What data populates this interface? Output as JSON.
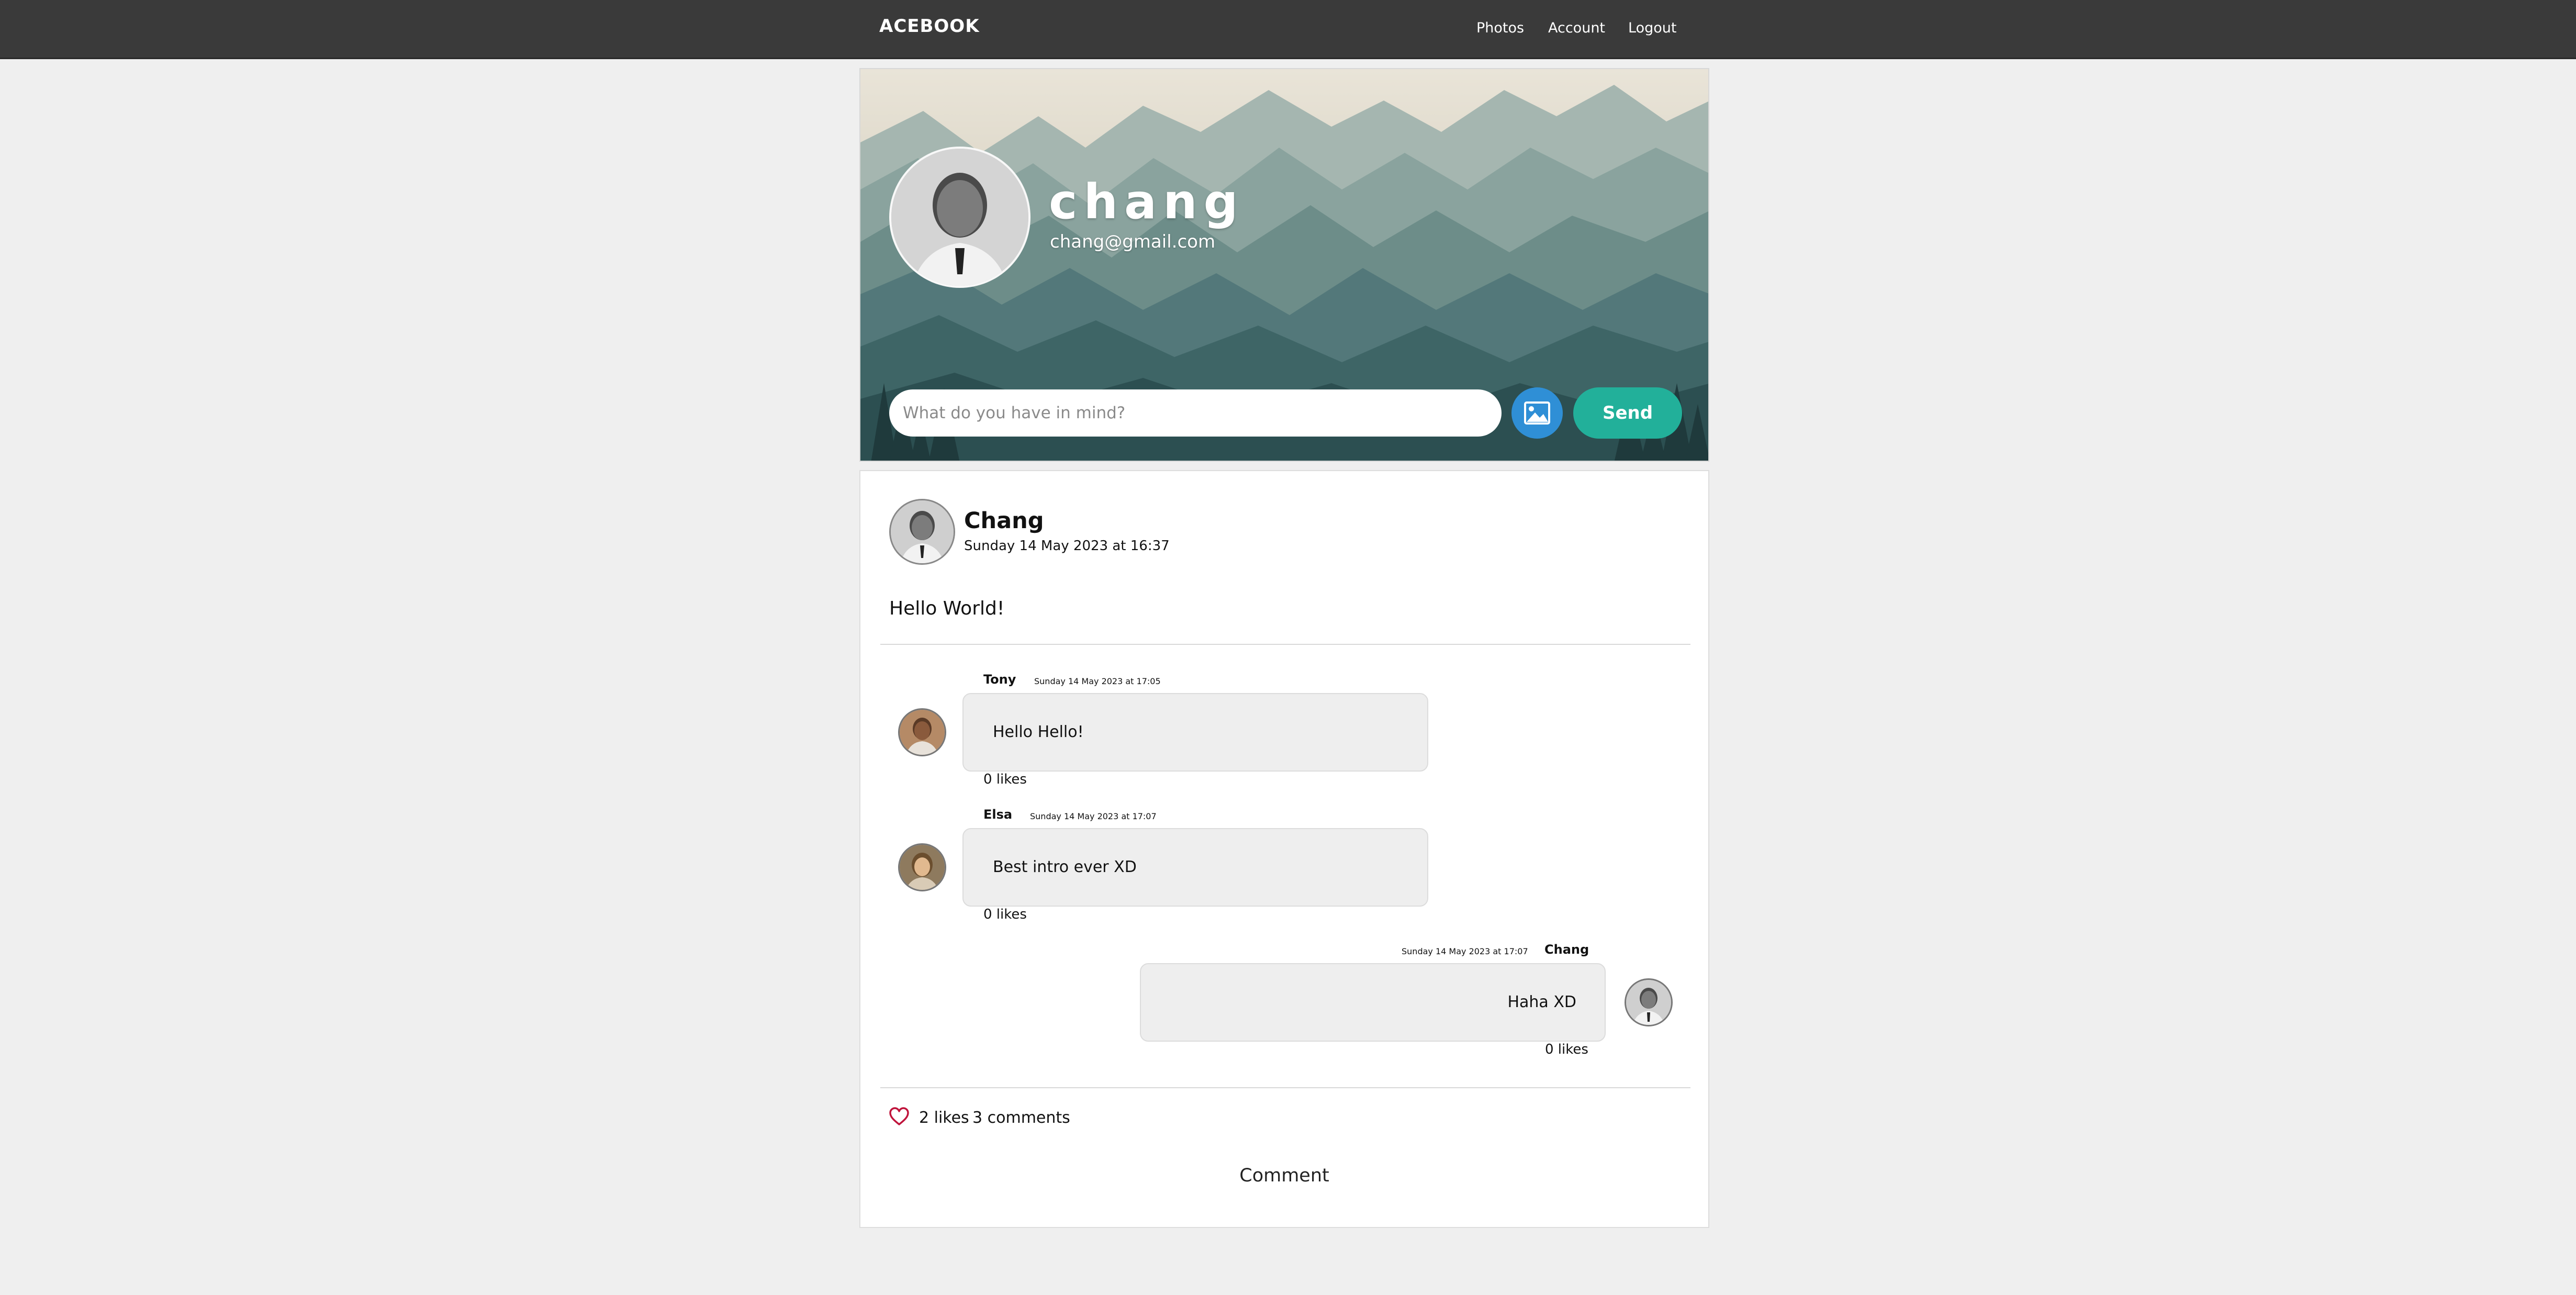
{
  "navbar": {
    "brand": "ACEBOOK",
    "links": [
      "Photos",
      "Account",
      "Logout"
    ]
  },
  "profile": {
    "name": "chang",
    "email": "chang@gmail.com",
    "avatar_icon": "profile-photo"
  },
  "composer": {
    "placeholder": "What do you have in mind?",
    "image_icon": "image-icon",
    "send_label": "Send"
  },
  "post": {
    "author": "Chang",
    "time": "Sunday 14 May 2023 at 16:37",
    "text": "Hello World!",
    "likes": "2 likes",
    "comments_count": "3 comments",
    "comment_button": "Comment",
    "heart_icon": "heart-icon",
    "heart_color": "#c0143c"
  },
  "comments": [
    {
      "author": "Tony",
      "time": "Sunday 14 May 2023 at 17:05",
      "text": "Hello Hello!",
      "likes": "0 likes"
    },
    {
      "author": "Elsa",
      "time": "Sunday 14 May 2023 at 17:07",
      "text": "Best intro ever XD",
      "likes": "0 likes"
    },
    {
      "author": "Chang",
      "time": "Sunday 14 May 2023 at 17:07",
      "text": "Haha XD",
      "likes": "0 likes"
    }
  ],
  "colors": {
    "navbar": "#3a3a3a",
    "send_button": "#22b09a",
    "image_button": "#2f8fd6",
    "page_background": "#efefef"
  }
}
